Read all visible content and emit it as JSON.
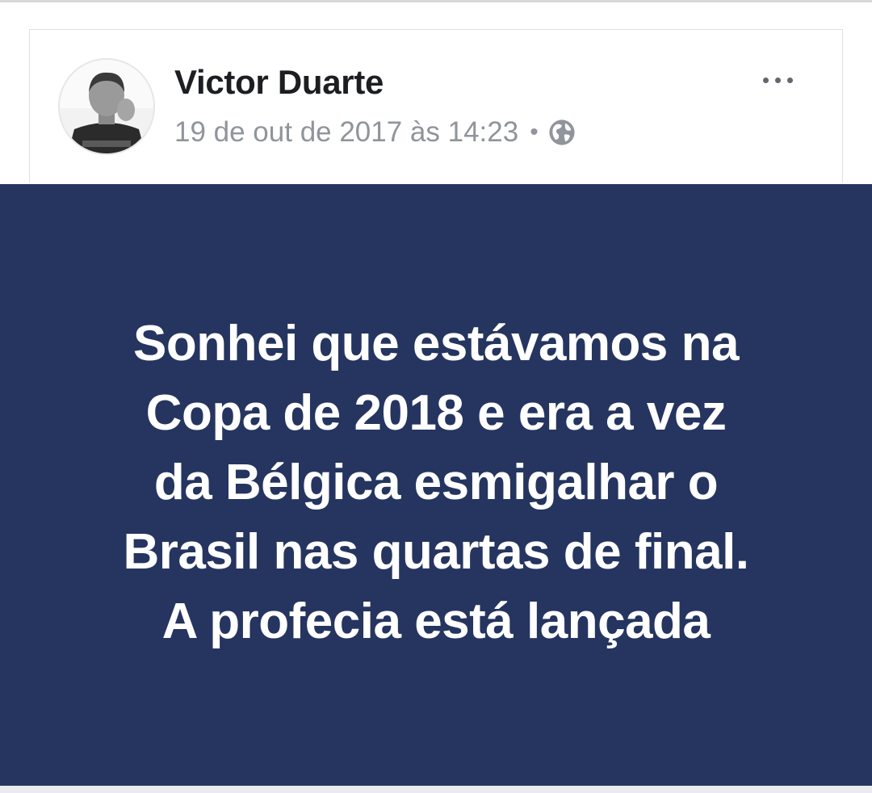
{
  "post": {
    "author": "Victor Duarte",
    "timestamp": "19 de out de 2017 às 14:23",
    "separator": "•",
    "privacy_icon": "globe-icon",
    "more_icon": "more-options-icon",
    "text_lines": [
      "Sonhei que estávamos na",
      "Copa de 2018 e era a vez",
      "da Bélgica esmigalhar o",
      "Brasil nas quartas de final.",
      "A profecia está lançada"
    ],
    "background_color": "#253560",
    "text_color": "#ffffff"
  }
}
